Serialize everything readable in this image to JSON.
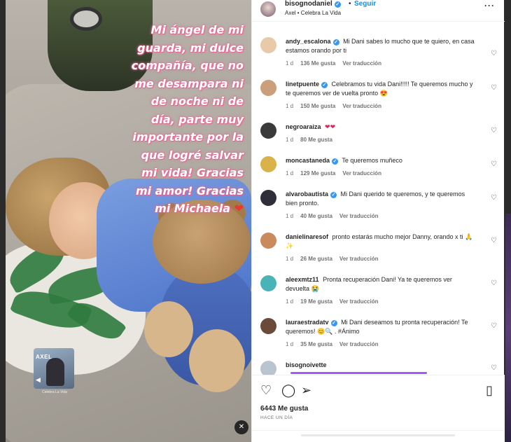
{
  "post": {
    "username": "bisognodaniel",
    "dot": "•",
    "follow_label": "Seguir",
    "audio": "Axel • Celebra La Vida",
    "more": "···",
    "story_text": "Mi ángel de mi guarda, mi dulce compañía, que no me desampara ni de noche ni de día, parte muy importante por la que logré salvar mi vida! Gracias mi amor! Gracias mi Michaela",
    "story_heart": "❤",
    "album": {
      "label": "AXEL",
      "caption": "Celebra La Vida"
    }
  },
  "comments": [
    {
      "user": "andy_escalona",
      "verified": true,
      "text": "Mi Dani sabes lo mucho que te quiero, en casa estamos orando por ti",
      "time": "1 d",
      "likes": "136 Me gusta",
      "translate": "Ver traducción",
      "avatar_color": "#e8c9a8"
    },
    {
      "user": "linetpuente",
      "verified": true,
      "text": "Celebramos tu vida Dani!!!!! Te queremos mucho y te queremos ver de vuelta pronto 😍",
      "time": "1 d",
      "likes": "150 Me gusta",
      "translate": "Ver traducción",
      "avatar_color": "#c9a07a"
    },
    {
      "user": "negroaraiza",
      "verified": false,
      "text": "❤❤",
      "time": "1 d",
      "likes": "80 Me gusta",
      "translate": "",
      "avatar_color": "#3a3a3a"
    },
    {
      "user": "moncastaneda",
      "verified": true,
      "text": "Te queremos muñeco",
      "time": "1 d",
      "likes": "129 Me gusta",
      "translate": "Ver traducción",
      "avatar_color": "#d9b24a"
    },
    {
      "user": "alvarobautista",
      "verified": true,
      "text": "Mi Dani querido te queremos, y te queremos bien pronto.",
      "time": "1 d",
      "likes": "40 Me gusta",
      "translate": "Ver traducción",
      "avatar_color": "#2f2f3a"
    },
    {
      "user": "danielinaresof",
      "verified": false,
      "text": "pronto estarás mucho mejor Danny, orando x ti 🙏✨",
      "time": "1 d",
      "likes": "26 Me gusta",
      "translate": "Ver traducción",
      "avatar_color": "#c98a5e"
    },
    {
      "user": "aleexmtz11",
      "verified": false,
      "text": "Pronta recuperación Dani! Ya te queremos ver devuelta 😭",
      "time": "1 d",
      "likes": "19 Me gusta",
      "translate": "Ver traducción",
      "avatar_color": "#4ab3b8"
    },
    {
      "user": "lauraestradatv",
      "verified": true,
      "text": "Mi Dani deseamos tu pronta recuperación! Te queremos! 😊🔍 . #Ánimo",
      "time": "1 d",
      "likes": "35 Me gusta",
      "translate": "Ver traducción",
      "avatar_color": "#6b4a3a"
    },
    {
      "user": "bisognoivette",
      "verified": false,
      "text": "",
      "time": "",
      "likes": "",
      "translate": "",
      "avatar_color": "#b9c4cf"
    }
  ],
  "actions": {
    "like_icon": "heart-icon",
    "comment_icon": "comment-icon",
    "share_icon": "share-icon",
    "save_icon": "bookmark-icon",
    "likes_count": "6443 Me gusta",
    "date": "HACE UN DÍA"
  },
  "colors": {
    "link": "#0095f6",
    "verified": "#3897f0",
    "muted": "#737373",
    "story_text_glow": "#f06a95"
  }
}
